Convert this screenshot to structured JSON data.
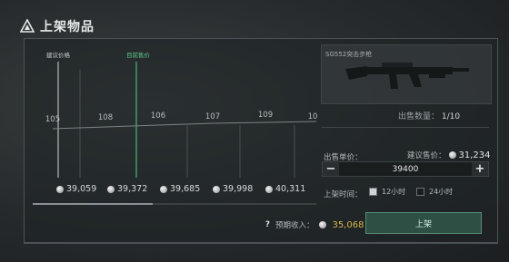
{
  "header": {
    "title": "上架物品"
  },
  "chart": {
    "suggested_label": "建议价格",
    "current_label": "目前售价",
    "quantities": [
      "105",
      "108",
      "106",
      "107",
      "109",
      "10"
    ],
    "prices": [
      "39,059",
      "39,372",
      "39,685",
      "39,998",
      "40,311"
    ]
  },
  "item": {
    "name": "SG552突击步枪",
    "quantity_label": "出售数量：",
    "quantity_value": "1/10"
  },
  "form": {
    "unit_price_label": "出售单价：",
    "suggested_price_label": "建议售价：",
    "suggested_price_value": "31,234",
    "minus": "−",
    "plus": "+",
    "price_value": "39400",
    "duration_label": "上架时间：",
    "option_12": "12小时",
    "option_24": "24小时"
  },
  "footer": {
    "help": "?",
    "income_label": "预期收入：",
    "income_value": "35,068",
    "list_button": "上架"
  },
  "colors": {
    "accent_green": "#5ec98e",
    "gold": "#d6b64a"
  }
}
